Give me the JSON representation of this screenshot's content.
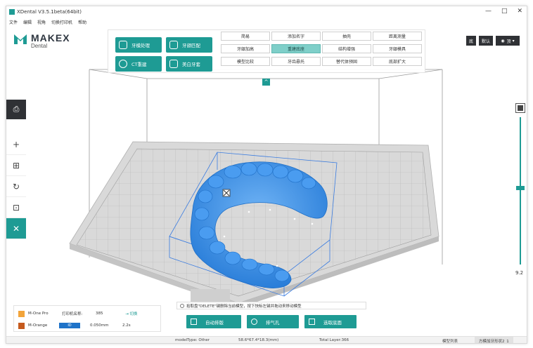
{
  "window": {
    "title": "XDental V3.5.1beta(64bit)",
    "controls": [
      "—",
      "□",
      "✕"
    ]
  },
  "menu": [
    "文件",
    "编辑",
    "视角",
    "切换打印机",
    "帮助"
  ],
  "logo": {
    "brand": "MAKEX",
    "sub": "Dental"
  },
  "toolbar": {
    "big_buttons": [
      {
        "label": "牙模处理",
        "icon": "tooth-scan-icon"
      },
      {
        "label": "牙颌匹配",
        "icon": "match-icon"
      },
      {
        "label": "CT重建",
        "icon": "ct-icon"
      },
      {
        "label": "美白牙套",
        "icon": "tooth-icon"
      }
    ],
    "grid_buttons": [
      [
        "简易",
        "添加名字",
        "抽壳",
        "距离测量"
      ],
      [
        "牙龈加高",
        "重建底座",
        "结构增强",
        "牙龈模具"
      ],
      [
        "模型比较",
        "牙齿悬托",
        "替代体预固",
        "底部扩大"
      ]
    ],
    "active_button": "重建底座",
    "collapse_icon": "^"
  },
  "top_right": {
    "btn1": "底",
    "btn2": "默认",
    "view_label": "顶",
    "eye_icon": "eye-icon"
  },
  "left_tools": {
    "print_icon": "printer-icon",
    "items": [
      {
        "name": "add-icon",
        "glyph": "+"
      },
      {
        "name": "layout-icon",
        "glyph": "⊞"
      },
      {
        "name": "rotate-icon",
        "glyph": "↻"
      },
      {
        "name": "scale-icon",
        "glyph": "⊡"
      },
      {
        "name": "makex-icon",
        "glyph": "✕"
      }
    ]
  },
  "slider": {
    "value": "9.2",
    "level": 0.52
  },
  "hint": "拾取盘\"DELETE\"键删除当前模型，按下快标左键并拖动来移动模型",
  "bottom_buttons": [
    {
      "label": "自动排版",
      "icon": "grid-icon"
    },
    {
      "label": "排气孔",
      "icon": "vent-icon"
    },
    {
      "label": "选取底面",
      "icon": "select-bottom-icon"
    }
  ],
  "printer": {
    "name": "M-One Pro",
    "name_label": "打印机名称:",
    "name_value": "385",
    "switch_label": "切换",
    "material": "M-Orange",
    "layer": "0.050mm",
    "time": "2.2s",
    "material_badge": "ID",
    "colors": {
      "printer": "#f2a43a",
      "material": "#c55a1e"
    }
  },
  "status": {
    "model_type": "modelType: Other",
    "size": "58.6*67.4*18.3(mm)",
    "layers": "Total Layer:366",
    "tab1": "模型列表",
    "tab2": "方模加牙形状2_1"
  },
  "colors": {
    "accent": "#1e9b94",
    "model": "#3d8fe6",
    "dark": "#2f3135"
  }
}
